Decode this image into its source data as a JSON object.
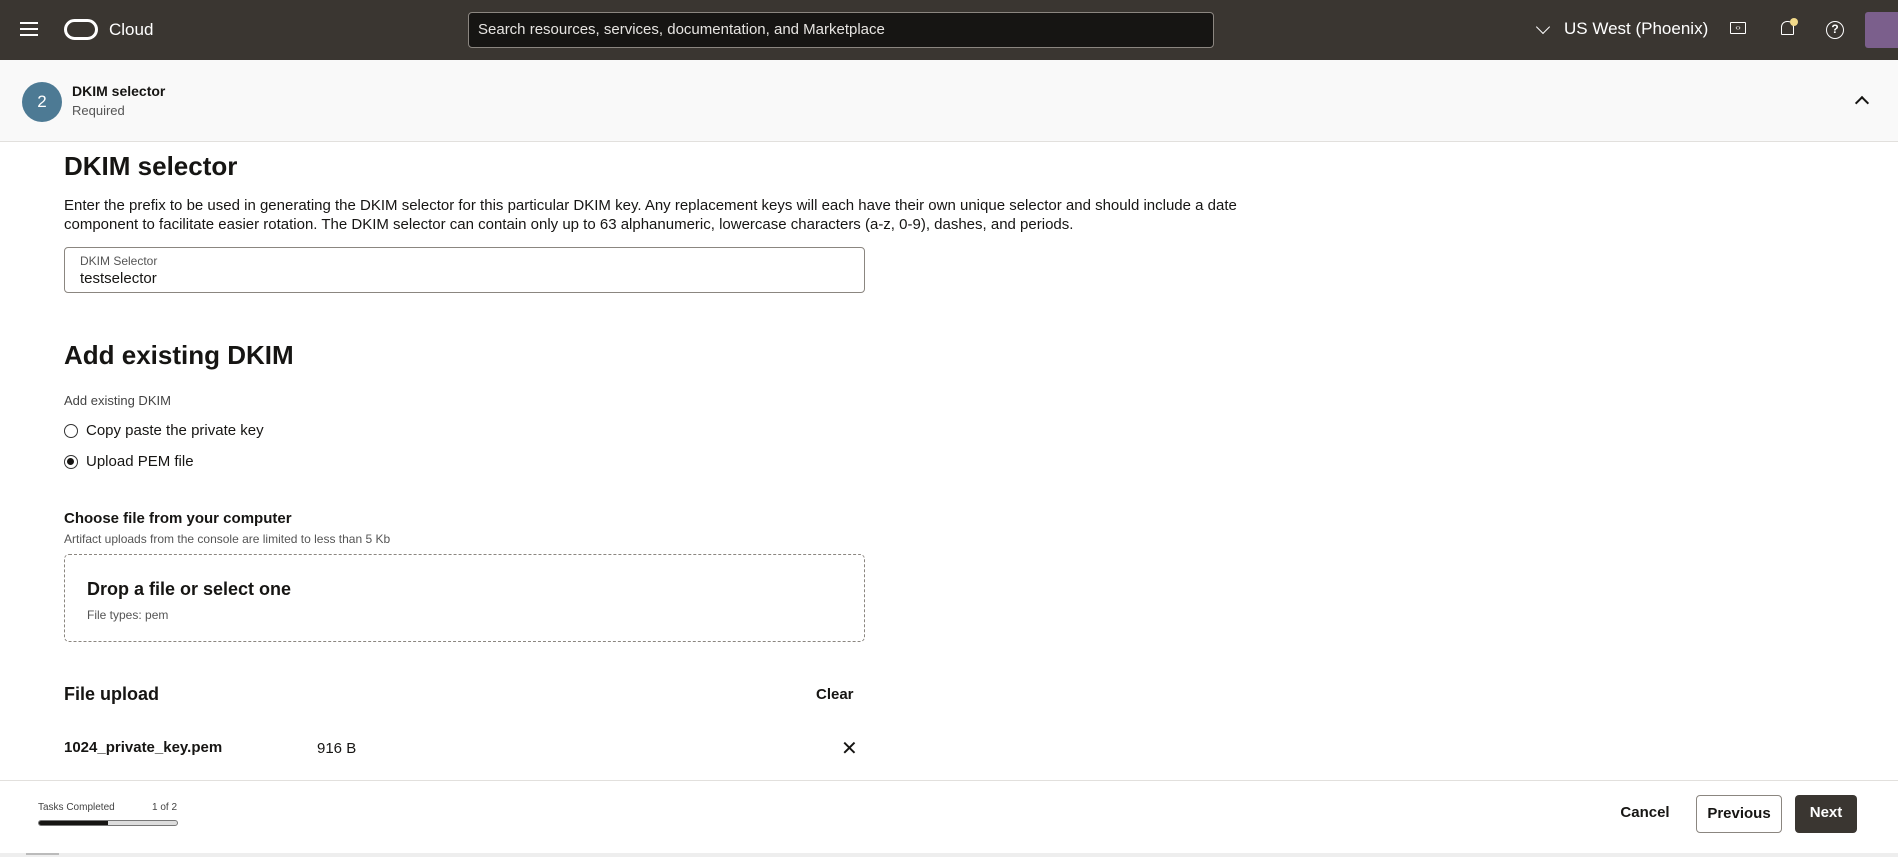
{
  "header": {
    "brand": "Cloud",
    "search_placeholder": "Search resources, services, documentation, and Marketplace",
    "region": "US West (Phoenix)"
  },
  "step": {
    "number": "2",
    "title": "DKIM selector",
    "subtitle": "Required"
  },
  "selector_section": {
    "heading": "DKIM selector",
    "description": "Enter the prefix to be used in generating the DKIM selector for this particular DKIM key. Any replacement keys will each have their own unique selector and should include a date component to facilitate easier rotation. The DKIM selector can contain only up to 63 alphanumeric, lowercase characters (a-z, 0-9), dashes, and periods.",
    "field_label": "DKIM Selector",
    "field_value": "testselector"
  },
  "existing_section": {
    "heading": "Add existing DKIM",
    "group_label": "Add existing DKIM",
    "options": [
      {
        "label": "Copy paste the private key",
        "selected": false
      },
      {
        "label": "Upload PEM file",
        "selected": true
      }
    ]
  },
  "file": {
    "label": "Choose file from your computer",
    "note": "Artifact uploads from the console are limited to less than 5 Kb",
    "drop_title": "Drop a file or select one",
    "drop_types": "File types: pem",
    "upload_heading": "File upload",
    "clear": "Clear",
    "file_name": "1024_private_key.pem",
    "file_size": "916 B"
  },
  "footer": {
    "tasks_label": "Tasks Completed",
    "tasks_count": "1 of 2",
    "progress": 0.5,
    "cancel": "Cancel",
    "previous": "Previous",
    "next": "Next"
  }
}
